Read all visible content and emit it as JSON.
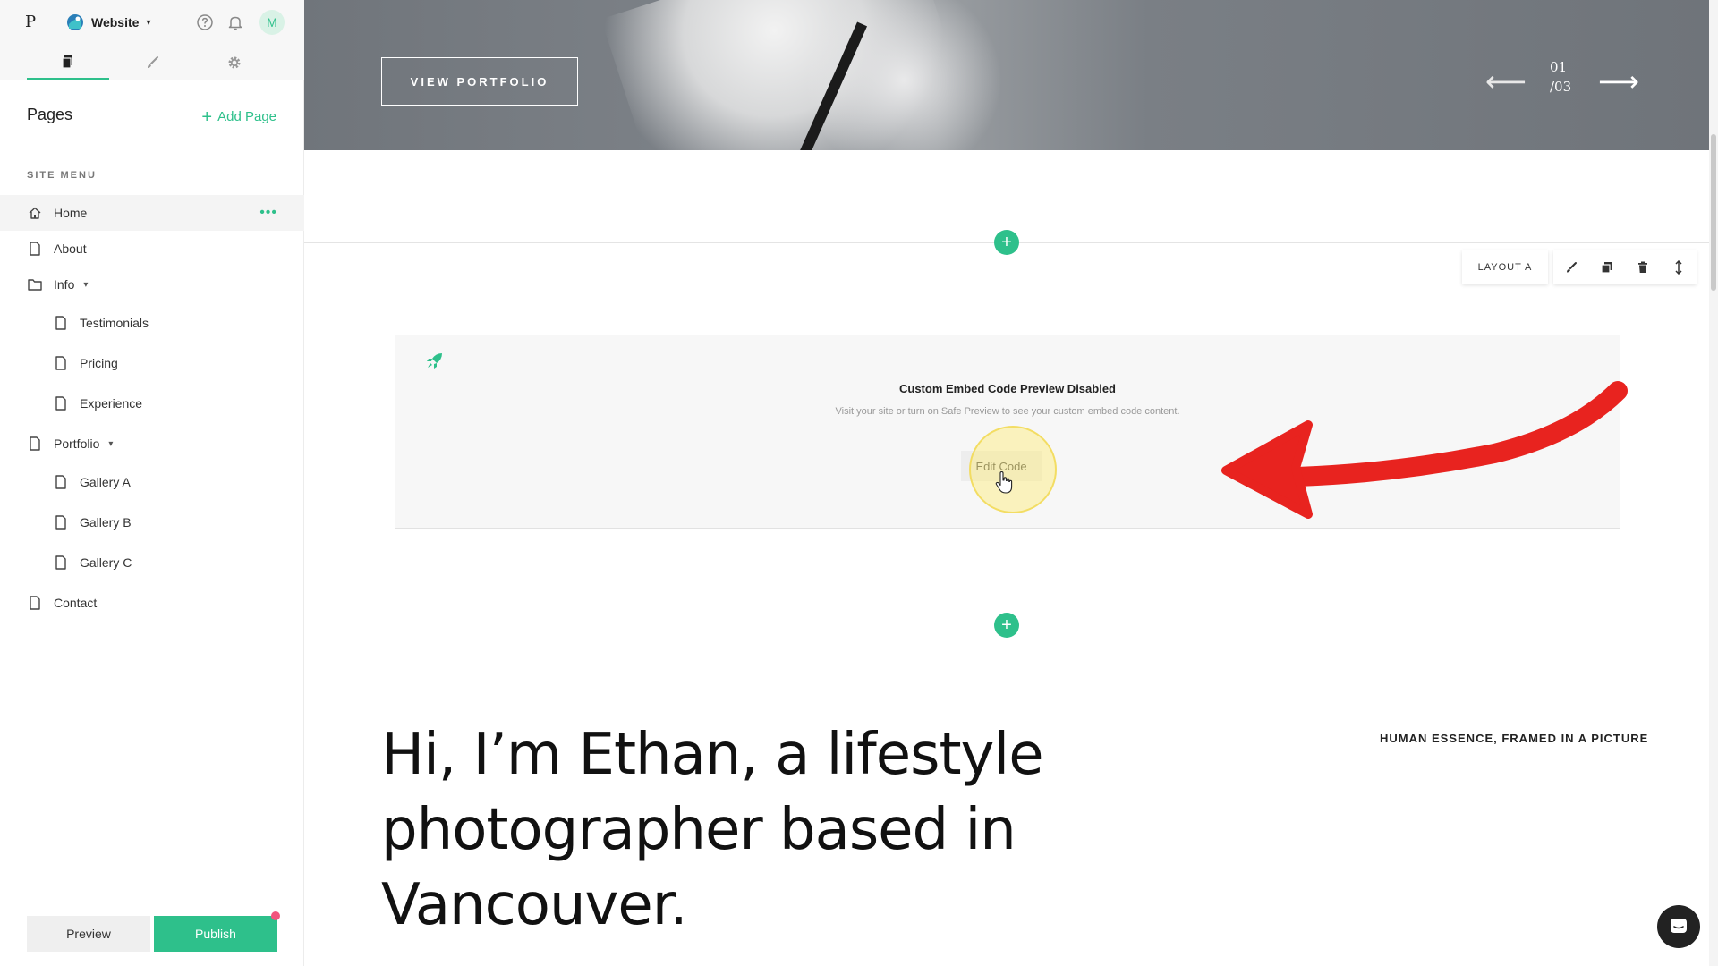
{
  "app": {
    "logo_letter": "P",
    "site_name": "Website",
    "avatar_letter": "M"
  },
  "sidebar": {
    "pages_title": "Pages",
    "add_page_label": "Add Page",
    "site_menu_label": "SITE MENU",
    "items": [
      {
        "label": "Home",
        "icon": "home-icon",
        "level": 0,
        "active": true
      },
      {
        "label": "About",
        "icon": "page-icon",
        "level": 0
      },
      {
        "label": "Info",
        "icon": "folder-icon",
        "level": 0,
        "expandable": true
      },
      {
        "label": "Testimonials",
        "icon": "page-icon",
        "level": 1
      },
      {
        "label": "Pricing",
        "icon": "page-icon",
        "level": 1
      },
      {
        "label": "Experience",
        "icon": "page-icon",
        "level": 1
      },
      {
        "label": "Portfolio",
        "icon": "page-icon",
        "level": 0,
        "expandable": true
      },
      {
        "label": "Gallery A",
        "icon": "page-icon",
        "level": 1
      },
      {
        "label": "Gallery B",
        "icon": "page-icon",
        "level": 1
      },
      {
        "label": "Gallery C",
        "icon": "page-icon",
        "level": 1
      },
      {
        "label": "Contact",
        "icon": "page-icon",
        "level": 0
      }
    ],
    "preview_label": "Preview",
    "publish_label": "Publish"
  },
  "hero": {
    "button_label": "VIEW PORTFOLIO",
    "slide_current": "01",
    "slide_total": "/03"
  },
  "section_toolbar": {
    "layout_label": "LAYOUT A"
  },
  "embed": {
    "title": "Custom Embed Code Preview Disabled",
    "subtitle": "Visit your site or turn on Safe Preview to see your custom embed code content.",
    "edit_label": "Edit Code"
  },
  "content": {
    "headline": "Hi, I’m Ethan, a lifestyle photographer based in Vancouver.",
    "tagline": "HUMAN ESSENCE, FRAMED IN A PICTURE"
  },
  "colors": {
    "accent": "#2ec08b",
    "annotation_arrow": "#e8231f",
    "highlight": "#ffec6e",
    "notification_dot": "#f2547d"
  }
}
